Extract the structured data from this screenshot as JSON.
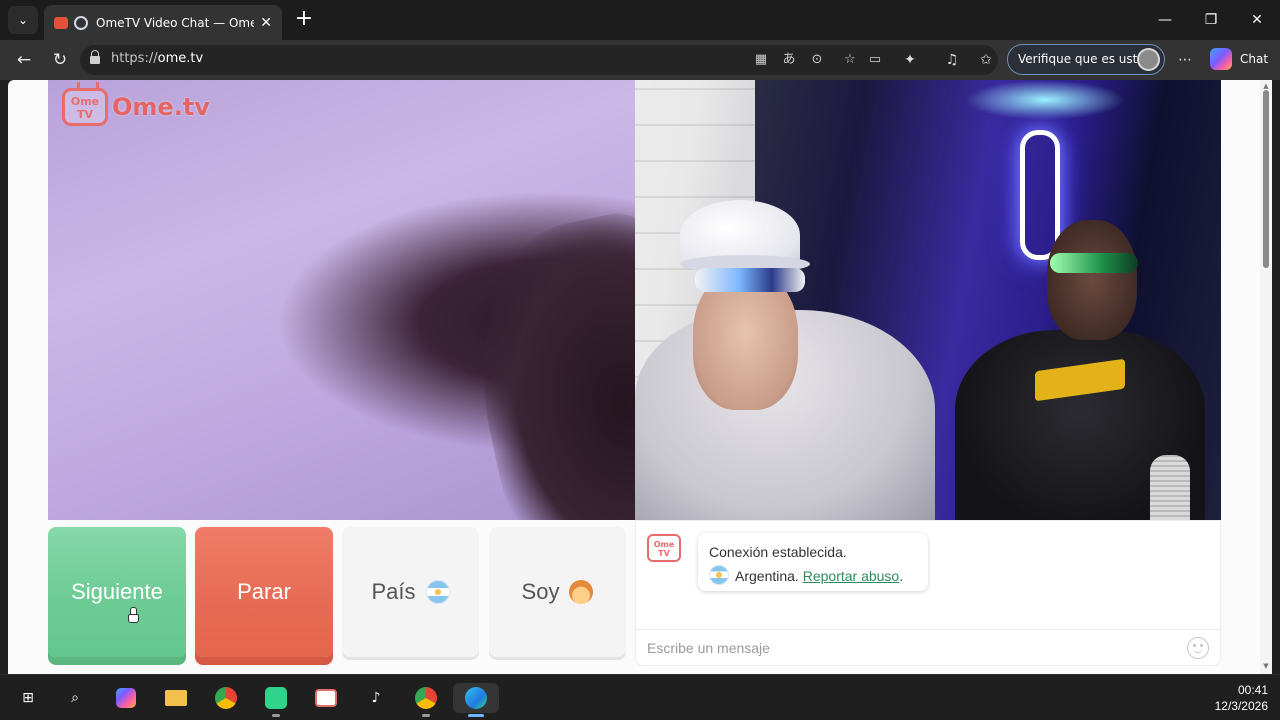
{
  "browser": {
    "tab_title": "OmeTV Video Chat — Omegl",
    "url_prefix": "https://",
    "url_domain": "ome.tv",
    "verify_label": "Verifique que es usted",
    "chat_label": "Chat"
  },
  "logo": {
    "badge_top": "Ome",
    "badge_bottom": "TV",
    "wordmark": "Ome.tv"
  },
  "controls": {
    "next_label": "Siguiente",
    "stop_label": "Parar",
    "country_label": "País",
    "gender_label": "Soy"
  },
  "chat": {
    "logo_top": "Ome",
    "logo_bottom": "TV",
    "status_message": "Conexión establecida.",
    "country": "Argentina.",
    "report_link": "Reportar abuso",
    "report_suffix": ".",
    "input_placeholder": "Escribe un mensaje"
  },
  "taskbar": {
    "time": "00:41",
    "date": "12/3/2026"
  },
  "colors": {
    "next_button": "#6dcc95",
    "stop_button": "#e76c55",
    "brand_red": "#e56565",
    "link_green": "#2d8c5a"
  }
}
